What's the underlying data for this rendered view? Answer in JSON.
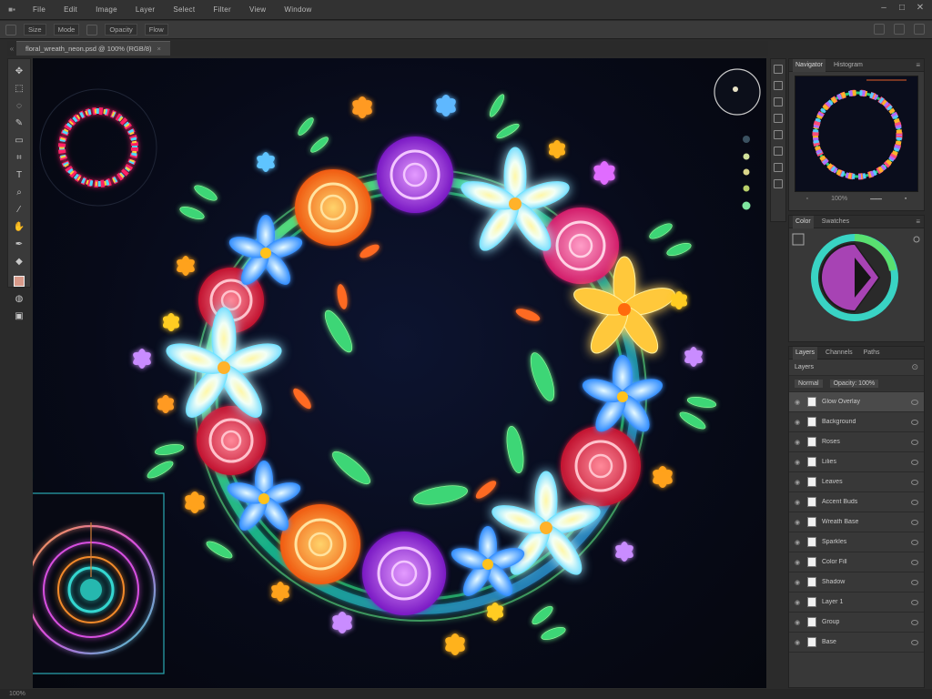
{
  "app": {
    "menu_items": [
      "File",
      "Edit",
      "Image",
      "Layer",
      "Select",
      "Filter",
      "View",
      "Window"
    ],
    "window_controls": [
      "–",
      "□",
      "✕"
    ]
  },
  "options_bar": {
    "fields": [
      "Size",
      "Mode",
      "Opacity",
      "Flow"
    ]
  },
  "document": {
    "tab_label": "floral_wreath_neon.psd @ 100% (RGB/8)",
    "tab_close": "×"
  },
  "toolbox": {
    "tools": [
      "move",
      "marquee",
      "lasso",
      "brush",
      "eraser",
      "crop",
      "type",
      "zoom",
      "eyedropper",
      "hand",
      "pen",
      "shape"
    ]
  },
  "panels": {
    "navigator": {
      "tabs": [
        "Navigator",
        "Histogram"
      ],
      "zoom": "100%"
    },
    "color": {
      "tabs": [
        "Color",
        "Swatches"
      ]
    },
    "layers": {
      "tabs": [
        "Layers",
        "Channels",
        "Paths"
      ],
      "header": "Layers",
      "blend_mode": "Normal",
      "opacity": "Opacity: 100%",
      "items": [
        {
          "name": "Glow Overlay",
          "selected": true
        },
        {
          "name": "Background",
          "selected": false
        },
        {
          "name": "Roses",
          "selected": false
        },
        {
          "name": "Lilies",
          "selected": false
        },
        {
          "name": "Leaves",
          "selected": false
        },
        {
          "name": "Accent Buds",
          "selected": false
        },
        {
          "name": "Wreath Base",
          "selected": false
        },
        {
          "name": "Sparkles",
          "selected": false
        },
        {
          "name": "Color Fill",
          "selected": false
        },
        {
          "name": "Shadow",
          "selected": false
        },
        {
          "name": "Layer 1",
          "selected": false
        },
        {
          "name": "Group",
          "selected": false
        },
        {
          "name": "Base",
          "selected": false
        }
      ]
    }
  },
  "status": {
    "text": "100%"
  },
  "colors": {
    "accent_teal": "#39d3c4",
    "accent_magenta": "#d74fe0",
    "panel_bg": "#383838"
  }
}
